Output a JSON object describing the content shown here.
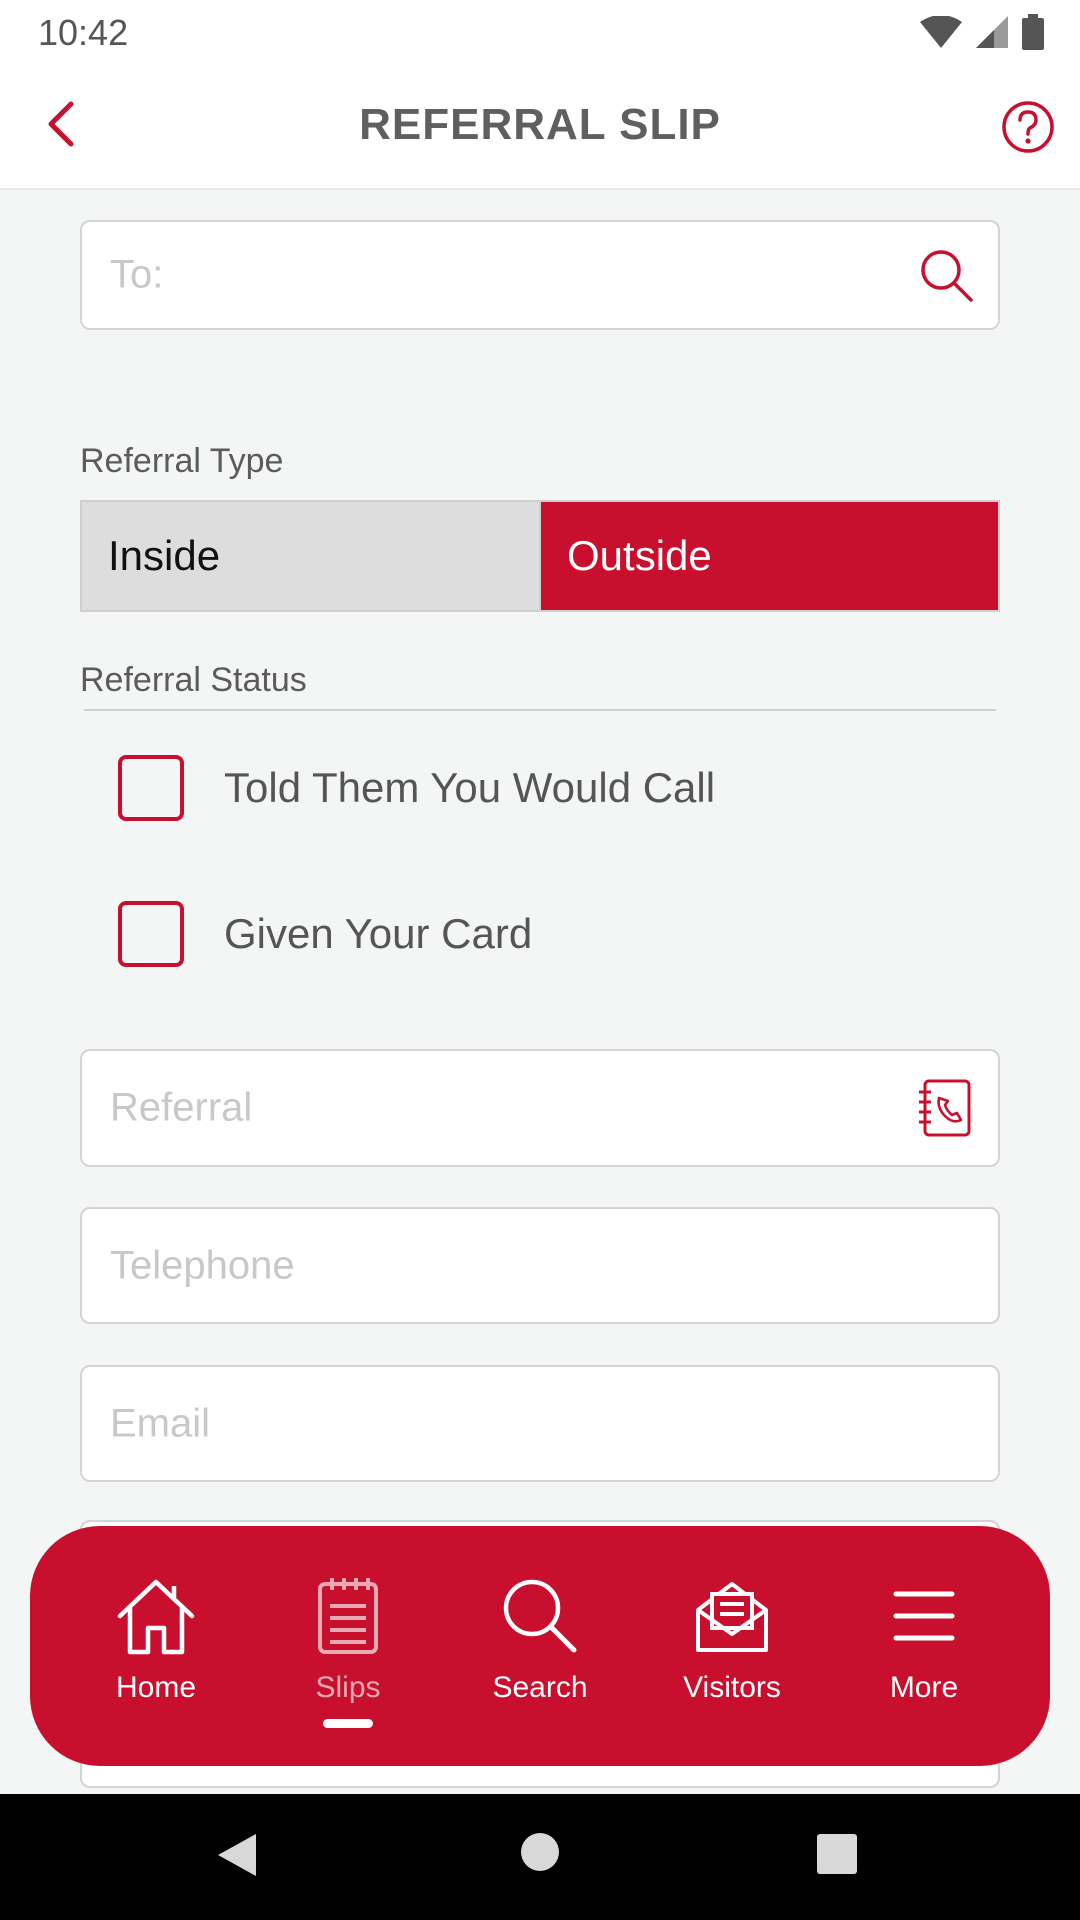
{
  "status_bar": {
    "time": "10:42"
  },
  "app_bar": {
    "title": "REFERRAL SLIP"
  },
  "to_field": {
    "placeholder": "To:"
  },
  "referral_type": {
    "label": "Referral Type",
    "options": [
      "Inside",
      "Outside"
    ],
    "selected": "Outside"
  },
  "referral_status": {
    "label": "Referral Status",
    "items": [
      {
        "label": "Told Them You Would Call",
        "checked": false
      },
      {
        "label": "Given Your Card",
        "checked": false
      }
    ]
  },
  "referral_field": {
    "placeholder": "Referral"
  },
  "telephone_field": {
    "placeholder": "Telephone"
  },
  "email_field": {
    "placeholder": "Email"
  },
  "bottom_nav": {
    "items": [
      {
        "label": "Home",
        "icon": "home-icon"
      },
      {
        "label": "Slips",
        "icon": "slips-icon",
        "active": true
      },
      {
        "label": "Search",
        "icon": "search-icon"
      },
      {
        "label": "Visitors",
        "icon": "visitors-icon"
      },
      {
        "label": "More",
        "icon": "menu-icon"
      }
    ]
  },
  "colors": {
    "accent": "#c8102e",
    "background": "#f4f5f5"
  }
}
